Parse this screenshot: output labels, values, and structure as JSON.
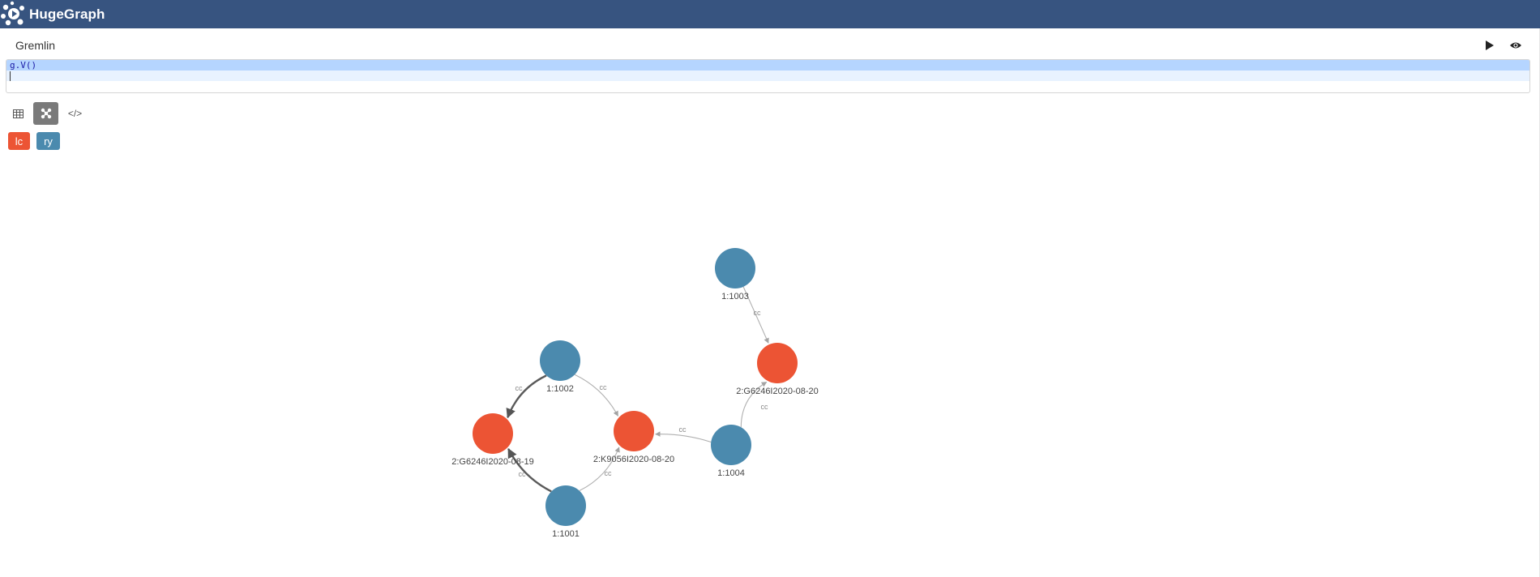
{
  "app": {
    "brand_name": "HugeGraph"
  },
  "query_panel": {
    "title": "Gremlin",
    "code": "g.V()"
  },
  "view_tabs": [
    {
      "name": "table",
      "icon": "table-icon"
    },
    {
      "name": "graph",
      "icon": "graph-icon",
      "active": true
    },
    {
      "name": "json",
      "icon": "code-icon",
      "label": "</>"
    }
  ],
  "legend": {
    "lc": {
      "label": "lc",
      "color": "#ec5434"
    },
    "ry": {
      "label": "ry",
      "color": "#4b8aae"
    }
  },
  "graph": {
    "nodes": [
      {
        "id": "1:1003",
        "label": "1:1003",
        "group": "ry"
      },
      {
        "id": "2:G6246I2020-08-20",
        "label": "2:G6246I2020-08-20",
        "group": "lc"
      },
      {
        "id": "1:1002",
        "label": "1:1002",
        "group": "ry"
      },
      {
        "id": "2:G6246I2020-08-19",
        "label": "2:G6246I2020-08-19",
        "group": "lc"
      },
      {
        "id": "2:K9056I2020-08-20",
        "label": "2:K9056I2020-08-20",
        "group": "lc"
      },
      {
        "id": "1:1004",
        "label": "1:1004",
        "group": "ry"
      },
      {
        "id": "1:1001",
        "label": "1:1001",
        "group": "ry"
      }
    ],
    "edges": [
      {
        "from": "1:1003",
        "to": "2:G6246I2020-08-20",
        "label": "cc"
      },
      {
        "from": "1:1004",
        "to": "2:G6246I2020-08-20",
        "label": "cc"
      },
      {
        "from": "1:1004",
        "to": "2:K9056I2020-08-20",
        "label": "cc"
      },
      {
        "from": "1:1002",
        "to": "2:K9056I2020-08-20",
        "label": "cc"
      },
      {
        "from": "1:1002",
        "to": "2:G6246I2020-08-19",
        "label": "cc"
      },
      {
        "from": "1:1001",
        "to": "2:G6246I2020-08-19",
        "label": "cc"
      },
      {
        "from": "1:1001",
        "to": "2:K9056I2020-08-20",
        "label": "cc"
      }
    ]
  }
}
